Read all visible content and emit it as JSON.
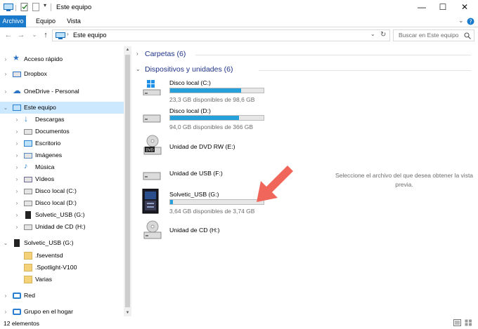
{
  "window": {
    "title": "Este equipo",
    "controls": {
      "minimize": "—",
      "maximize": "☐",
      "close": "✕"
    }
  },
  "ribbon": {
    "tabs": [
      {
        "label": "Archivo",
        "active": true
      },
      {
        "label": "Equipo",
        "active": false
      },
      {
        "label": "Vista",
        "active": false
      }
    ],
    "expand_icon": "chevron-down-icon",
    "help_icon": "help-icon"
  },
  "address": {
    "path": "Este equipo",
    "search_placeholder": "Buscar en Este equipo"
  },
  "nav": {
    "items": [
      {
        "label": "Acceso rápido",
        "icon": "star-icon",
        "chevron": "›"
      },
      {
        "label": "Dropbox",
        "icon": "dropbox-icon",
        "chevron": "›"
      },
      {
        "label": "OneDrive - Personal",
        "icon": "cloud-icon",
        "chevron": "›"
      },
      {
        "label": "Este equipo",
        "icon": "computer-icon",
        "chevron": "⌄",
        "selected": true
      },
      {
        "label": "Descargas",
        "icon": "download-icon",
        "chevron": "›"
      },
      {
        "label": "Documentos",
        "icon": "documents-icon",
        "chevron": "›"
      },
      {
        "label": "Escritorio",
        "icon": "desktop-icon",
        "chevron": "›"
      },
      {
        "label": "Imágenes",
        "icon": "pictures-icon",
        "chevron": "›"
      },
      {
        "label": "Música",
        "icon": "music-icon",
        "chevron": "›"
      },
      {
        "label": "Vídeos",
        "icon": "videos-icon",
        "chevron": "›"
      },
      {
        "label": "Disco local (C:)",
        "icon": "drive-icon",
        "chevron": "›"
      },
      {
        "label": "Disco local (D:)",
        "icon": "drive-icon",
        "chevron": "›"
      },
      {
        "label": "Solvetic_USB (G:)",
        "icon": "usb-drive-icon",
        "chevron": "›"
      },
      {
        "label": "Unidad de CD (H:)",
        "icon": "cd-drive-icon",
        "chevron": "›"
      },
      {
        "label": "Solvetic_USB (G:)",
        "icon": "usb-drive-icon",
        "chevron": "⌄"
      },
      {
        "label": ".fseventsd",
        "icon": "folder-icon",
        "chevron": ""
      },
      {
        "label": ".Spotlight-V100",
        "icon": "folder-icon",
        "chevron": ""
      },
      {
        "label": "Varias",
        "icon": "folder-icon",
        "chevron": ""
      },
      {
        "label": "Red",
        "icon": "network-icon",
        "chevron": "›"
      },
      {
        "label": "Grupo en el hogar",
        "icon": "homegroup-icon",
        "chevron": "›"
      }
    ]
  },
  "content": {
    "groups": [
      {
        "label": "Carpetas (6)",
        "expanded": false
      },
      {
        "label": "Dispositivos y unidades (6)",
        "expanded": true
      }
    ],
    "devices": [
      {
        "name": "Disco local (C:)",
        "space": "23,3 GB disponibles de 98,6 GB",
        "used_fraction": 0.76,
        "icon": "windows-drive-icon"
      },
      {
        "name": "Disco local (D:)",
        "space": "94,0 GB disponibles de 366 GB",
        "used_fraction": 0.74,
        "icon": "drive-icon"
      },
      {
        "name": "Unidad de DVD RW (E:)",
        "space": "",
        "icon": "dvd-drive-icon"
      },
      {
        "name": "Unidad de USB (F:)",
        "space": "",
        "icon": "usb-drive-icon"
      },
      {
        "name": "Solvetic_USB (G:)",
        "space": "3,64 GB disponibles de 3,74 GB",
        "used_fraction": 0.03,
        "icon": "solvetic-usb-icon",
        "highlight_arrow": true
      },
      {
        "name": "Unidad de CD (H:)",
        "space": "",
        "icon": "cd-drive-icon"
      }
    ]
  },
  "preview_text": "Seleccione el archivo del que desea obtener la vista previa.",
  "status": {
    "items_count": "12 elementos"
  },
  "colors": {
    "accent": "#1979ca",
    "selection": "#cce8ff",
    "bar_fill": "#26a0da",
    "group_header": "#1e3287",
    "arrow": "#f0665a"
  }
}
